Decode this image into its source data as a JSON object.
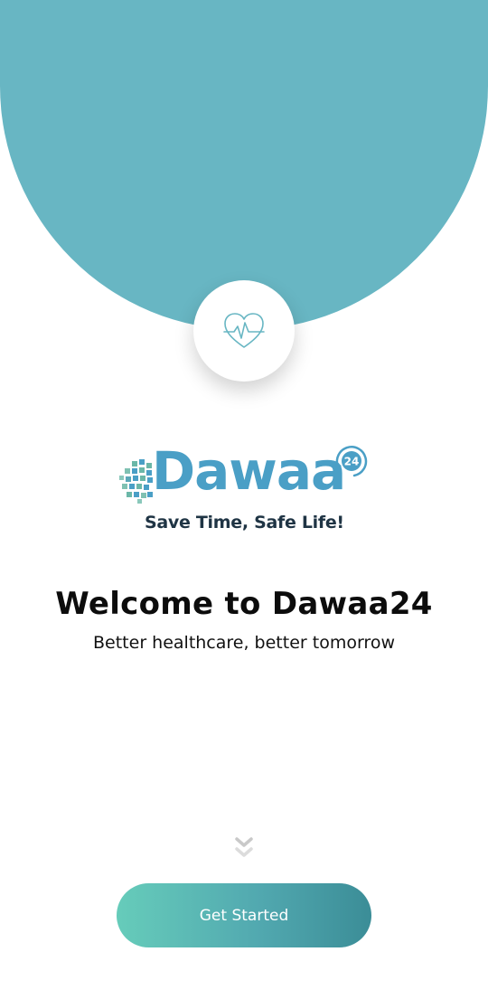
{
  "header": {
    "background_color": "#68b6c3",
    "badge_icon": "heart-pulse-icon"
  },
  "logo": {
    "wordmark": "Dawaa",
    "badge_number": "24",
    "tagline": "Save Time, Safe Life!",
    "brand_color": "#4a9fc6"
  },
  "welcome": {
    "title": "Welcome to Dawaa24",
    "subtitle": "Better healthcare, better tomorrow"
  },
  "scroll_hint": {
    "icon": "double-chevron-down-icon"
  },
  "cta": {
    "label": "Get Started",
    "gradient_start": "#66ccba",
    "gradient_end": "#3b8d97"
  }
}
